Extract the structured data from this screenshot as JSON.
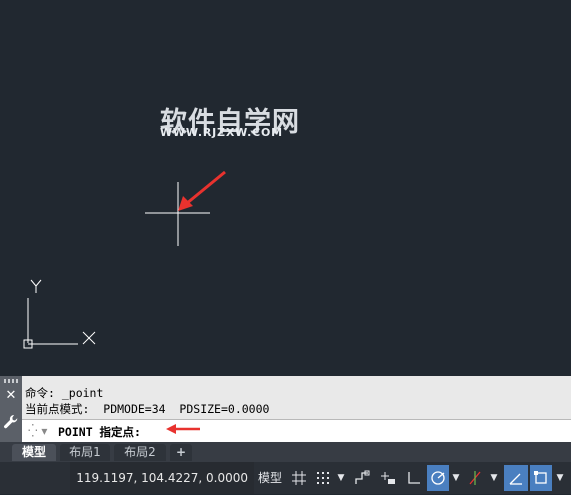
{
  "watermark": {
    "title": "软件自学网",
    "url": "WWW.RJZXW.COM"
  },
  "ucs": {
    "x_label": "X",
    "y_label": "Y"
  },
  "command": {
    "history": [
      "命令: _point",
      "当前点模式:  PDMODE=34  PDSIZE=0.0000"
    ],
    "prompt": "POINT 指定点:"
  },
  "layout_tabs": [
    {
      "label": "模型",
      "active": true
    },
    {
      "label": "布局1",
      "active": false
    },
    {
      "label": "布局2",
      "active": false
    },
    {
      "label": "+",
      "active": false
    }
  ],
  "status": {
    "coordinates": "119.1197, 104.4227, 0.0000",
    "model_label": "模型"
  },
  "colors": {
    "canvas": "#212830",
    "crosshair": "#ffffff",
    "arrow": "#e8322e",
    "accent_on": "#4a7fc0"
  }
}
